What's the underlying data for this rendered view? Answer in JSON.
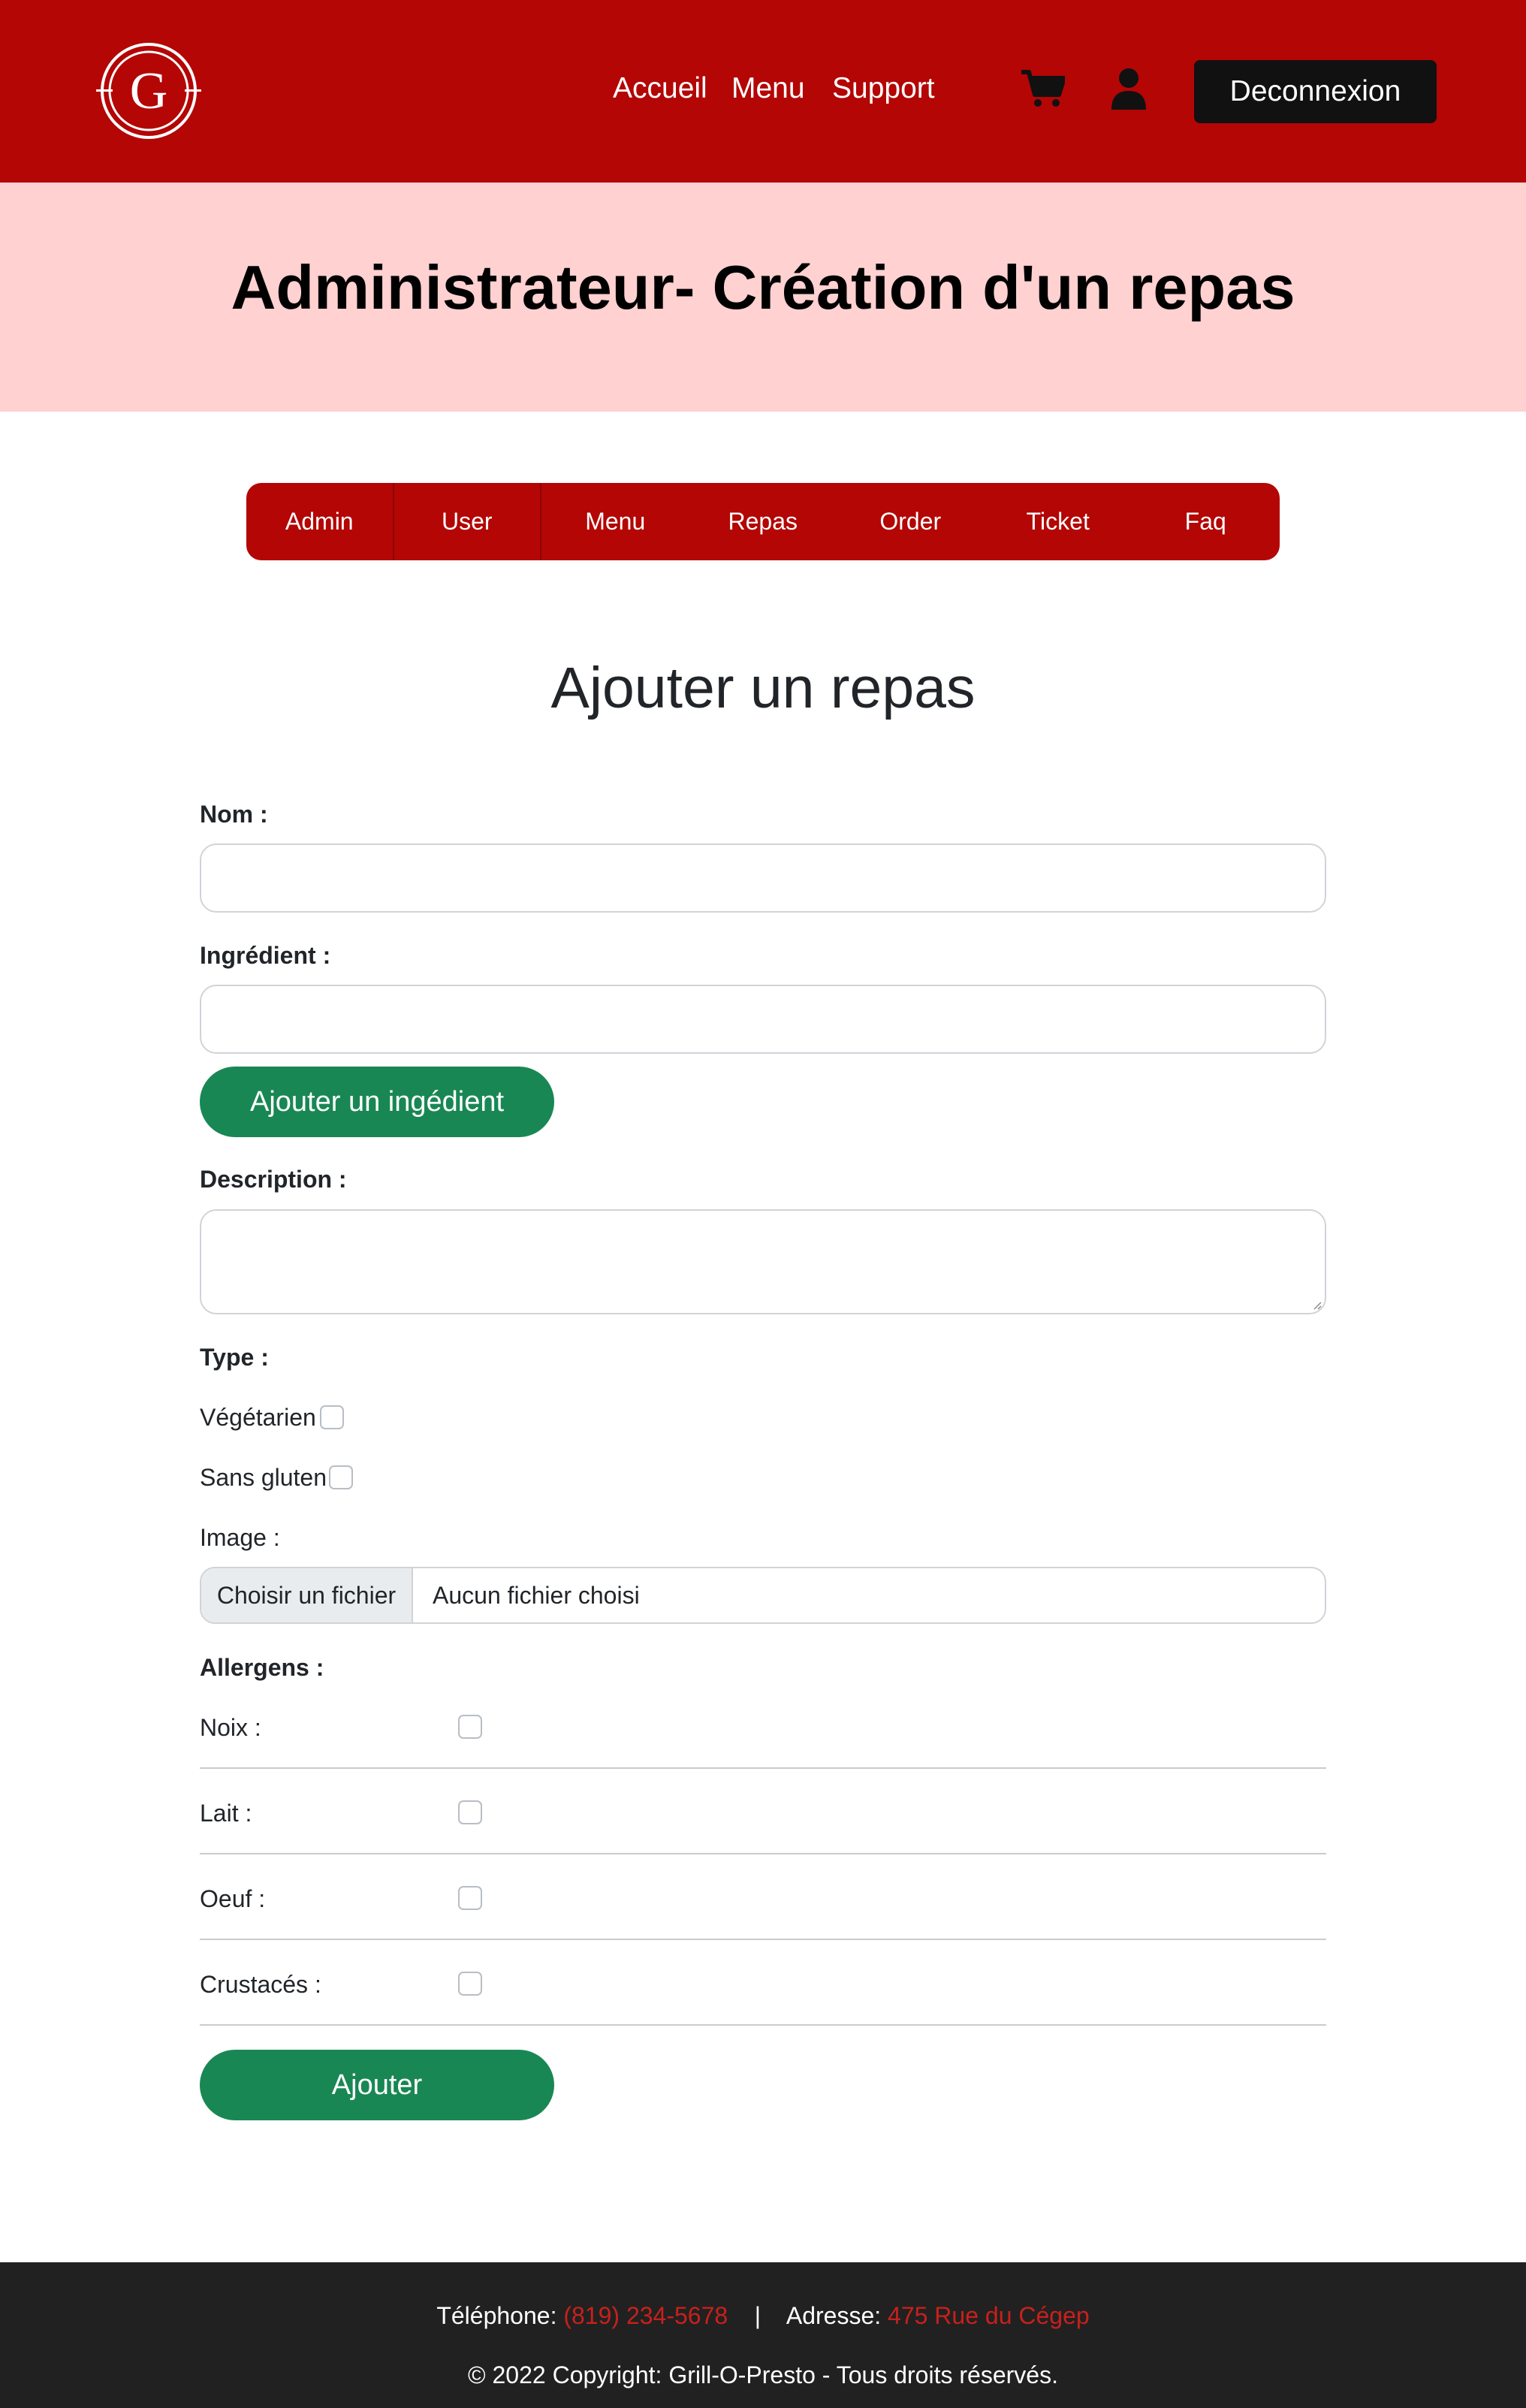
{
  "header": {
    "logo_letter": "G",
    "nav": [
      "Accueil",
      "Menu",
      "Support"
    ],
    "logout_label": "Deconnexion",
    "brand_color": "#b30605"
  },
  "hero": {
    "title": "Administrateur- Création d'un repas"
  },
  "tabs": [
    "Admin",
    "User",
    "Menu",
    "Repas",
    "Order",
    "Ticket",
    "Faq"
  ],
  "form": {
    "heading": "Ajouter un repas",
    "nom_label": "Nom :",
    "nom_value": "",
    "ingredient_label": "Ingrédient :",
    "ingredient_value": "",
    "add_ingredient_button": "Ajouter un ingédient",
    "description_label": "Description :",
    "description_value": "",
    "type_label": "Type :",
    "types": [
      {
        "label": "Végétarien",
        "checked": false
      },
      {
        "label": "Sans gluten",
        "checked": false
      }
    ],
    "image_label": "Image :",
    "file_button": "Choisir un fichier",
    "file_status": "Aucun fichier choisi",
    "allergens_label": "Allergens :",
    "allergens": [
      {
        "label": "Noix :",
        "checked": false
      },
      {
        "label": "Lait :",
        "checked": false
      },
      {
        "label": "Oeuf :",
        "checked": false
      },
      {
        "label": "Crustacés :",
        "checked": false
      }
    ],
    "submit_button": "Ajouter",
    "button_color": "#198754"
  },
  "footer": {
    "phone_label": "Téléphone:",
    "phone_value": "(819) 234-5678",
    "separator": "|",
    "address_label": "Adresse:",
    "address_value": "475 Rue du Cégep",
    "copyright": "© 2022 Copyright: Grill-O-Presto - Tous droits réservés."
  }
}
